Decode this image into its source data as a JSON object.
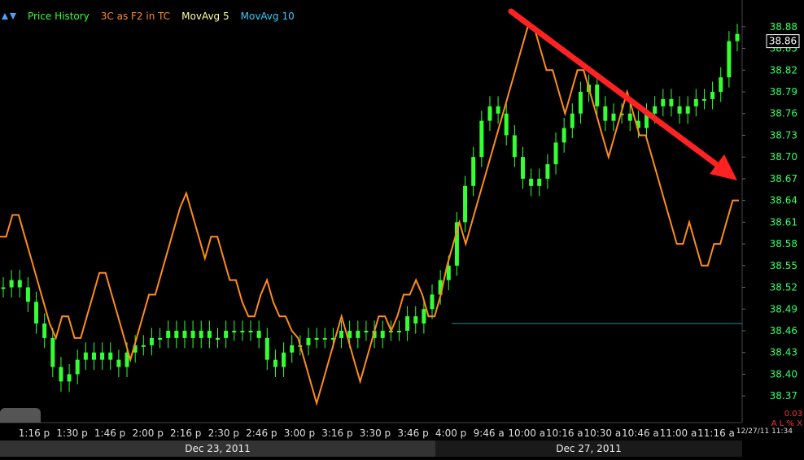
{
  "legend": {
    "price_history": "Price History",
    "indicator": "3C as F2 in TC",
    "ma5": "MovAvg 5",
    "ma10": "MovAvg 10"
  },
  "colors": {
    "price_green": "#33ff33",
    "indicator_orange": "#ff8c1a",
    "ma5_yellow": "#ffff99",
    "ma10_cyan": "#33ccff",
    "axis_green": "#33ff66",
    "annotation_red": "#ff2222",
    "background": "#000000"
  },
  "chart_data": {
    "type": "line",
    "title": "",
    "ylim": [
      38.35,
      38.9
    ],
    "y_ticks": [
      "38.88",
      "38.85",
      "38.82",
      "38.79",
      "38.76",
      "38.73",
      "38.70",
      "38.67",
      "38.64",
      "38.61",
      "38.58",
      "38.55",
      "38.52",
      "38.49",
      "38.46",
      "38.43",
      "38.40",
      "38.37"
    ],
    "last_price_label": "38.86",
    "last_price": 38.86,
    "reference_line": 38.47,
    "x_labels": [
      "1:16 p",
      "1:30 p",
      "1:46 p",
      "2:00 p",
      "2:16 p",
      "2:30 p",
      "2:46 p",
      "3:00 p",
      "3:16 p",
      "3:30 p",
      "3:46 p",
      "4:00 p",
      "9:46 a",
      "10:00 a",
      "10:16 a",
      "10:30 a",
      "10:46 a",
      "11:00 a",
      "11:16 a"
    ],
    "date_labels": [
      "Dec 23, 2011",
      "Dec 27, 2011"
    ],
    "corner_stamp": "12/27/11 11:34",
    "status_value": "0.03",
    "status_flags": "A L % X",
    "series": [
      {
        "name": "3C as F2 in TC",
        "style": "orange line (indicator, independent scale)",
        "values": [
          38.59,
          38.59,
          38.62,
          38.62,
          38.59,
          38.56,
          38.53,
          38.5,
          38.47,
          38.45,
          38.48,
          38.48,
          38.45,
          38.45,
          38.48,
          38.51,
          38.54,
          38.54,
          38.51,
          38.48,
          38.45,
          38.42,
          38.45,
          38.48,
          38.51,
          38.51,
          38.54,
          38.57,
          38.6,
          38.63,
          38.65,
          38.62,
          38.59,
          38.56,
          38.59,
          38.59,
          38.56,
          38.53,
          38.53,
          38.5,
          38.48,
          38.48,
          38.51,
          38.53,
          38.5,
          38.48,
          38.48,
          38.46,
          38.45,
          38.42,
          38.39,
          38.36,
          38.39,
          38.42,
          38.45,
          38.48,
          38.45,
          38.42,
          38.39,
          38.42,
          38.45,
          38.48,
          38.48,
          38.46,
          38.48,
          38.51,
          38.51,
          38.53,
          38.51,
          38.48,
          38.48,
          38.51,
          38.55,
          38.58,
          38.61,
          38.58,
          38.61,
          38.64,
          38.67,
          38.7,
          38.73,
          38.76,
          38.79,
          38.82,
          38.85,
          38.88,
          38.88,
          38.85,
          38.82,
          38.82,
          38.79,
          38.76,
          38.79,
          38.82,
          38.82,
          38.79,
          38.76,
          38.73,
          38.7,
          38.73,
          38.76,
          38.79,
          38.76,
          38.73,
          38.73,
          38.7,
          38.67,
          38.64,
          38.61,
          38.58,
          38.58,
          38.61,
          38.58,
          38.55,
          38.55,
          38.58,
          38.58,
          38.61,
          38.64,
          38.64
        ]
      },
      {
        "name": "Price History",
        "style": "green candles",
        "values": [
          38.52,
          38.53,
          38.52,
          38.5,
          38.47,
          38.45,
          38.41,
          38.39,
          38.4,
          38.42,
          38.43,
          38.42,
          38.43,
          38.42,
          38.41,
          38.43,
          38.44,
          38.44,
          38.45,
          38.45,
          38.46,
          38.45,
          38.46,
          38.45,
          38.46,
          38.45,
          38.45,
          38.46,
          38.46,
          38.46,
          38.46,
          38.45,
          38.42,
          38.41,
          38.43,
          38.44,
          38.44,
          38.45,
          38.45,
          38.45,
          38.45,
          38.46,
          38.45,
          38.46,
          38.46,
          38.45,
          38.46,
          38.46,
          38.46,
          38.48,
          38.47,
          38.49,
          38.51,
          38.53,
          38.55,
          38.61,
          38.66,
          38.7,
          38.75,
          38.77,
          38.76,
          38.73,
          38.7,
          38.67,
          38.66,
          38.67,
          38.69,
          38.72,
          38.74,
          38.76,
          38.79,
          38.8,
          38.77,
          38.75,
          38.76,
          38.76,
          38.75,
          38.74,
          38.76,
          38.77,
          38.78,
          38.77,
          38.76,
          38.77,
          38.78,
          38.78,
          38.79,
          38.81,
          38.86,
          38.87
        ]
      }
    ]
  }
}
